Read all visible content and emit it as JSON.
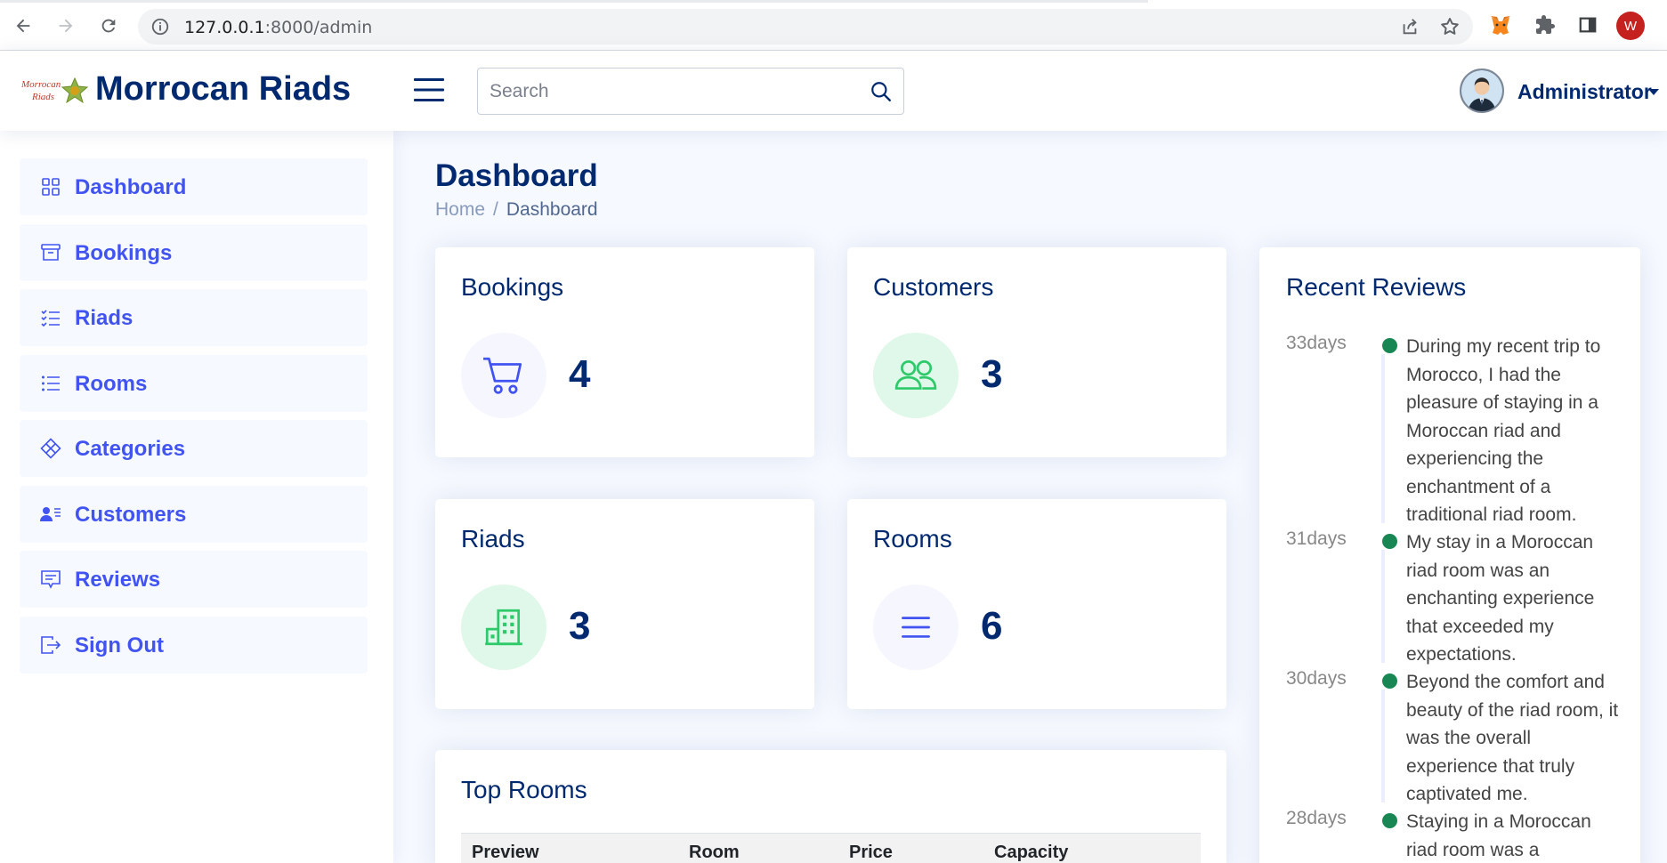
{
  "browser": {
    "url_host": "127.0.0.1",
    "url_path": ":8000/admin",
    "profile_initial": "W"
  },
  "header": {
    "brand": "Morrocan Riads",
    "logo_text_line1": "Morrocan",
    "logo_text_line2": "Riads",
    "search_placeholder": "Search",
    "user_name": "Administrator"
  },
  "sidebar": {
    "items": [
      {
        "label": "Dashboard",
        "icon": "grid-icon"
      },
      {
        "label": "Bookings",
        "icon": "archive-icon"
      },
      {
        "label": "Riads",
        "icon": "list-check-icon"
      },
      {
        "label": "Rooms",
        "icon": "list-icon"
      },
      {
        "label": "Categories",
        "icon": "diamond-icon"
      },
      {
        "label": "Customers",
        "icon": "person-lines-icon"
      },
      {
        "label": "Reviews",
        "icon": "chat-square-text-icon"
      },
      {
        "label": "Sign Out",
        "icon": "box-arrow-right-icon"
      }
    ]
  },
  "main": {
    "title": "Dashboard",
    "breadcrumb": {
      "home": "Home",
      "current": "Dashboard",
      "separator": "/"
    },
    "stats": {
      "bookings": {
        "title": "Bookings",
        "value": "4",
        "icon": "cart-icon",
        "color": "#4154f1",
        "bg": "#f6f6fe"
      },
      "customers": {
        "title": "Customers",
        "value": "3",
        "icon": "people-icon",
        "color": "#2eca6a",
        "bg": "#e0f8e9"
      },
      "riads": {
        "title": "Riads",
        "value": "3",
        "icon": "building-icon",
        "color": "#2eca6a",
        "bg": "#e0f8e9"
      },
      "rooms": {
        "title": "Rooms",
        "value": "6",
        "icon": "list-icon",
        "color": "#4154f1",
        "bg": "#f6f6fe"
      }
    },
    "top_rooms": {
      "title": "Top Rooms",
      "columns": [
        "Preview",
        "Room",
        "Price",
        "Capacity"
      ]
    },
    "recent_reviews": {
      "title": "Recent Reviews",
      "items": [
        {
          "ago": "33days",
          "text": "During my recent trip to Morocco, I had the pleasure of staying in a Moroccan riad and experiencing the enchantment of a traditional riad room."
        },
        {
          "ago": "31days",
          "text": "My stay in a Moroccan riad room was an enchanting experience that exceeded my expectations."
        },
        {
          "ago": "30days",
          "text": "Beyond the comfort and beauty of the riad room, it was the overall experience that truly captivated me."
        },
        {
          "ago": "28days",
          "text": "Staying in a Moroccan riad room was a"
        }
      ]
    }
  }
}
